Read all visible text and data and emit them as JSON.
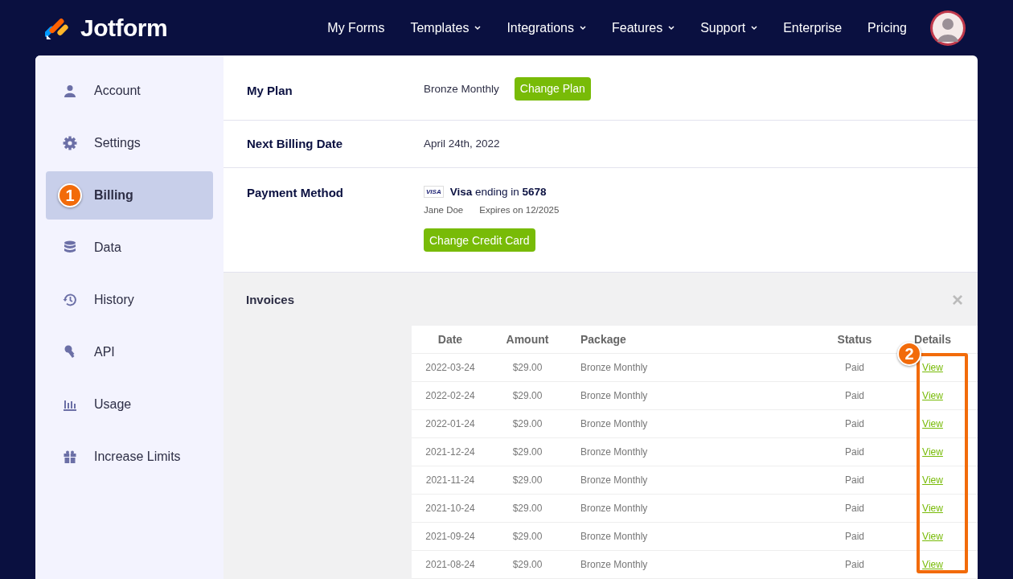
{
  "brand": {
    "name": "Jotform"
  },
  "nav": [
    {
      "label": "My Forms",
      "has_menu": false
    },
    {
      "label": "Templates",
      "has_menu": true
    },
    {
      "label": "Integrations",
      "has_menu": true
    },
    {
      "label": "Features",
      "has_menu": true
    },
    {
      "label": "Support",
      "has_menu": true
    },
    {
      "label": "Enterprise",
      "has_menu": false
    },
    {
      "label": "Pricing",
      "has_menu": false
    }
  ],
  "sidebar": {
    "items": [
      {
        "label": "Account",
        "kind": "user",
        "selected": false
      },
      {
        "label": "Settings",
        "kind": "gear",
        "selected": false
      },
      {
        "label": "Billing",
        "selected": true,
        "annotation": "1"
      },
      {
        "label": "Data",
        "kind": "database",
        "selected": false
      },
      {
        "label": "History",
        "kind": "history",
        "selected": false
      },
      {
        "label": "API",
        "kind": "key",
        "selected": false
      },
      {
        "label": "Usage",
        "kind": "chart",
        "selected": false
      },
      {
        "label": "Increase Limits",
        "kind": "gift",
        "selected": false
      }
    ]
  },
  "plan": {
    "label": "My Plan",
    "value": "Bronze Monthly",
    "button": "Change Plan"
  },
  "next_billing": {
    "label": "Next Billing Date",
    "value": "April 24th, 2022"
  },
  "payment": {
    "label": "Payment Method",
    "card_brand": "VISA",
    "card_text": "**Visa** ending in **5678**",
    "holder": "Jane Doe",
    "expires": "Expires on 12/2025",
    "button": "Change Credit Card"
  },
  "invoices": {
    "title": "Invoices",
    "close": "×",
    "columns": [
      "Date",
      "Amount",
      "Package",
      "Status",
      "Details"
    ],
    "details_annotation": "2",
    "rows": [
      {
        "date": "2022-03-24",
        "amount": "$29.00",
        "package": "Bronze Monthly",
        "status": "Paid",
        "details": "View"
      },
      {
        "date": "2022-02-24",
        "amount": "$29.00",
        "package": "Bronze Monthly",
        "status": "Paid",
        "details": "View"
      },
      {
        "date": "2022-01-24",
        "amount": "$29.00",
        "package": "Bronze Monthly",
        "status": "Paid",
        "details": "View"
      },
      {
        "date": "2021-12-24",
        "amount": "$29.00",
        "package": "Bronze Monthly",
        "status": "Paid",
        "details": "View"
      },
      {
        "date": "2021-11-24",
        "amount": "$29.00",
        "package": "Bronze Monthly",
        "status": "Paid",
        "details": "View"
      },
      {
        "date": "2021-10-24",
        "amount": "$29.00",
        "package": "Bronze Monthly",
        "status": "Paid",
        "details": "View"
      },
      {
        "date": "2021-09-24",
        "amount": "$29.00",
        "package": "Bronze Monthly",
        "status": "Paid",
        "details": "View"
      },
      {
        "date": "2021-08-24",
        "amount": "$29.00",
        "package": "Bronze Monthly",
        "status": "Paid",
        "details": "View"
      }
    ]
  }
}
